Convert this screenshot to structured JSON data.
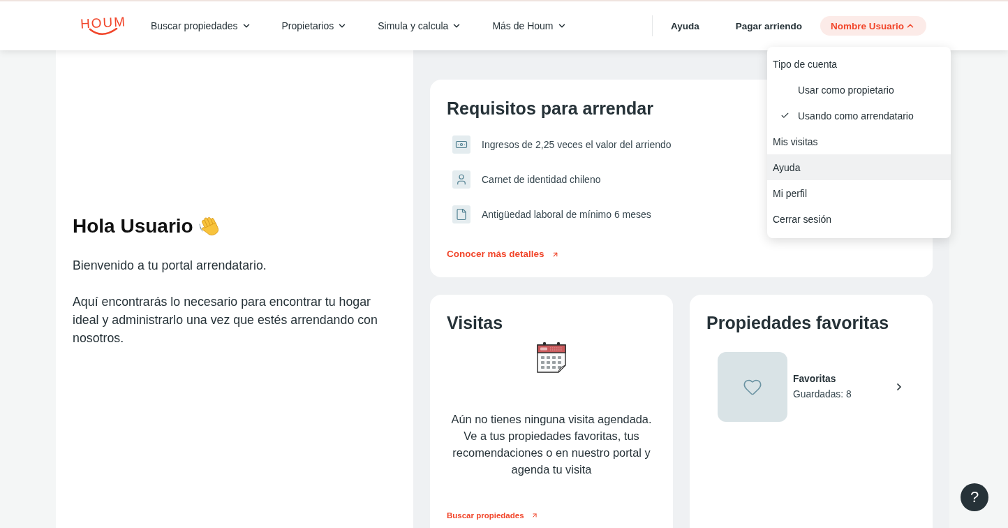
{
  "header": {
    "logo": "HOUM",
    "nav_menus": [
      {
        "label": "Buscar propiedades",
        "expanded": false
      },
      {
        "label": "Propietarios",
        "expanded": false
      },
      {
        "label": "Simula y calcula",
        "expanded": false
      },
      {
        "label": "Más de Houm",
        "expanded": false
      }
    ],
    "links": [
      "Ayuda",
      "Pagar arriendo"
    ],
    "user_menu": {
      "label": "Nombre Usuario",
      "expanded": true,
      "dropdown": {
        "heading": "Tipo de cuenta",
        "account_options": [
          {
            "label": "Usar como propietario",
            "checked": false
          },
          {
            "label": "Usando como arrendatario",
            "checked": true
          }
        ],
        "items": [
          {
            "label": "Mis visitas",
            "highlighted": false
          },
          {
            "label": "Ayuda",
            "highlighted": true
          },
          {
            "label": "Mi perfil",
            "highlighted": false
          },
          {
            "label": "Cerrar sesión",
            "highlighted": false
          }
        ]
      }
    }
  },
  "welcome": {
    "title": "Hola Usuario",
    "paragraphs": [
      "Bienvenido a tu portal arrendatario.",
      "Aquí encontrarás lo necesario para encontrar tu hogar ideal y administrarlo una vez que estés arrendando con nosotros."
    ]
  },
  "requirements": {
    "title": "Requisitos para arrendar",
    "items": [
      {
        "kind": "income",
        "text": "Ingresos de 2,25 veces el valor del arriendo"
      },
      {
        "kind": "identity",
        "text": "Carnet de identidad chileno"
      },
      {
        "kind": "document",
        "text": "Antigüedad laboral de mínimo 6 meses"
      }
    ],
    "link": "Conocer más detalles"
  },
  "visits": {
    "title": "Visitas",
    "empty_message": "Aún no tienes ninguna visita agendada. Ve a tus propiedades favoritas, tus recomendaciones o en nuestro portal y agenda tu visita",
    "link": "Buscar propiedades"
  },
  "favorites": {
    "title": "Propiedades favoritas",
    "collections": [
      {
        "name": "Favoritas",
        "count": "Guardadas: 8"
      }
    ]
  },
  "help_button": {
    "label": "?"
  }
}
